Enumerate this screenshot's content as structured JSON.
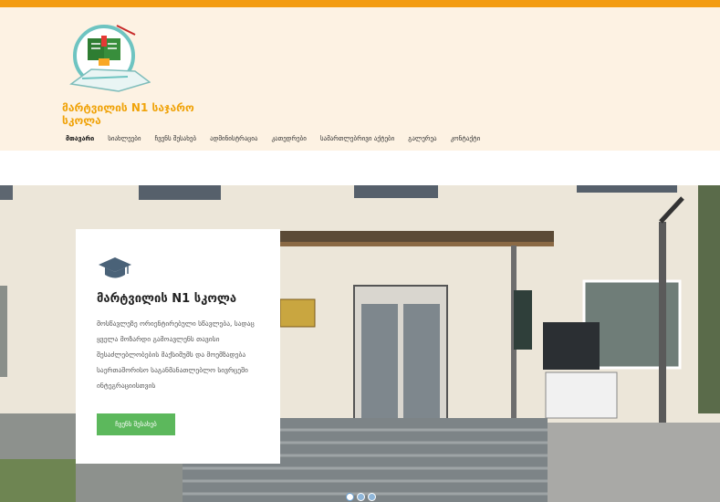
{
  "site": {
    "name": "მარტვილის N1 საჯარო სკოლა"
  },
  "nav": {
    "items": [
      "მთავარი",
      "სიახლეები",
      "ჩვენს შესახებ",
      "ადმინისტრაცია",
      "კათედრები",
      "სამართლებრივი აქტები",
      "გალერეა",
      "კონტაქტი"
    ],
    "active_index": 0
  },
  "hero": {
    "card": {
      "icon": "graduation-cap-icon",
      "title": "მარტვილის N1 სკოლა",
      "text": "მოსწავლეზე ორიენტირებული სწავლება, სადაც ყველა მოზარდი გამოავლენს თავისი შესაძლებლობების მაქსიმუმს და მოემზადება საერთაშორისო საგანმანათლებლო სივრცეში ინტეგრაციისთვის",
      "button_label": "ჩვენს შესახებ"
    },
    "slider": {
      "count": 3,
      "active": 0
    }
  },
  "colors": {
    "accent": "#f39c12",
    "header_bg": "#fdf2e3",
    "button": "#5cb85c",
    "site_name": "#f0a30a"
  }
}
